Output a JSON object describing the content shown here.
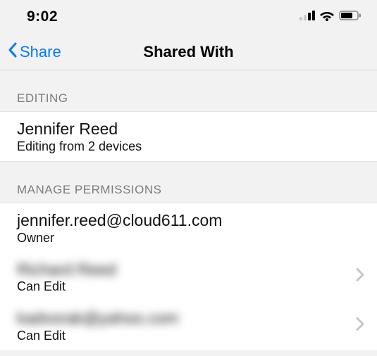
{
  "status": {
    "time": "9:02"
  },
  "nav": {
    "back_label": "Share",
    "title": "Shared With"
  },
  "sections": {
    "editing_header": "EDITING",
    "manage_header": "MANAGE PERMISSIONS"
  },
  "editing": {
    "name": "Jennifer Reed",
    "detail": "Editing from 2 devices"
  },
  "permissions": [
    {
      "title": "jennifer.reed@cloud611.com",
      "sub": "Owner",
      "blurred": false,
      "disclosure": false
    },
    {
      "title": "Richard Reed",
      "sub": "Can Edit",
      "blurred": true,
      "disclosure": true
    },
    {
      "title": "kadvorak@yahoo.com",
      "sub": "Can Edit",
      "blurred": true,
      "disclosure": true
    }
  ]
}
